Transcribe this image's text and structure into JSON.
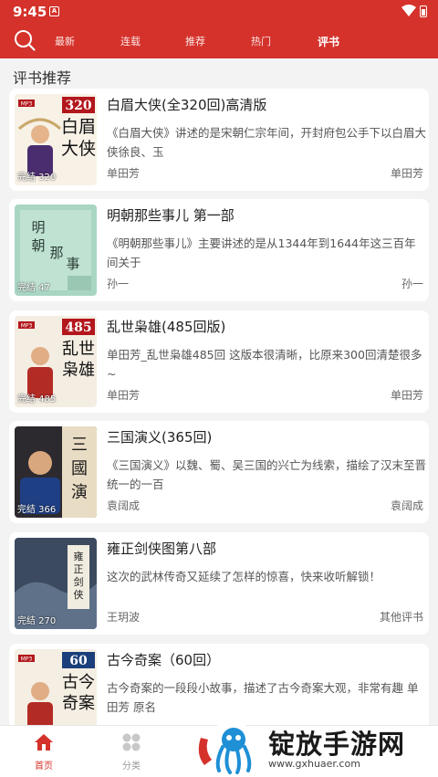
{
  "status_bar": {
    "time": "9:45",
    "notification_glyph": "A"
  },
  "nav": {
    "tabs": [
      "最新",
      "连载",
      "推荐",
      "热门",
      "评书"
    ],
    "active_tab": "评书",
    "colors": {
      "primary": "#d4322b"
    }
  },
  "section": {
    "title": "评书推荐"
  },
  "books": [
    {
      "title": "白眉大侠(全320回)高清版",
      "desc": "《白眉大侠》讲述的是宋朝仁宗年间，开封府包公手下以白眉大侠徐良、玉",
      "author": "单田芳",
      "category": "单田芳",
      "tag": "完结 320",
      "cover_badge": "320",
      "cover_text": "白眉大侠"
    },
    {
      "title": "明朝那些事儿 第一部",
      "desc": "《明朝那些事儿》主要讲述的是从1344年到1644年这三百年间关于",
      "author": "孙一",
      "category": "孙一",
      "tag": "完结 47",
      "cover_badge": "",
      "cover_text": "明朝那些事儿"
    },
    {
      "title": "乱世枭雄(485回版)",
      "desc": "单田芳_乱世枭雄485回  这版本很清晰，比原来300回清楚很多~",
      "author": "单田芳",
      "category": "单田芳",
      "tag": "完结 485",
      "cover_badge": "485",
      "cover_text": "乱世枭雄"
    },
    {
      "title": "三国演义(365回)",
      "desc": "《三国演义》以魏、蜀、吴三国的兴亡为线索，描绘了汉末至晋统一的一百",
      "author": "袁阔成",
      "category": "袁阔成",
      "tag": "完结 366",
      "cover_badge": "",
      "cover_text": "三國演義"
    },
    {
      "title": "雍正剑侠图第八部",
      "desc": "这次的武林传奇又延续了怎样的惊喜，快来收听解锁！",
      "author": "王玥波",
      "category": "其他评书",
      "tag": "完结 270",
      "cover_badge": "",
      "cover_text": "雍正剑侠图"
    },
    {
      "title": "古今奇案（60回）",
      "desc": "古今奇案的一段段小故事，描述了古今奇案大观，非常有趣 单田芳 原名",
      "author": "",
      "category": "",
      "tag": "",
      "cover_badge": "60",
      "cover_text": "古今奇案"
    }
  ],
  "bottom_nav": [
    {
      "label": "首页",
      "icon": "home-icon",
      "active": true
    },
    {
      "label": "分类",
      "icon": "grid-icon",
      "active": false
    }
  ],
  "watermark": {
    "text": "锭放手游网",
    "url": "www.gxhuaer.com"
  }
}
